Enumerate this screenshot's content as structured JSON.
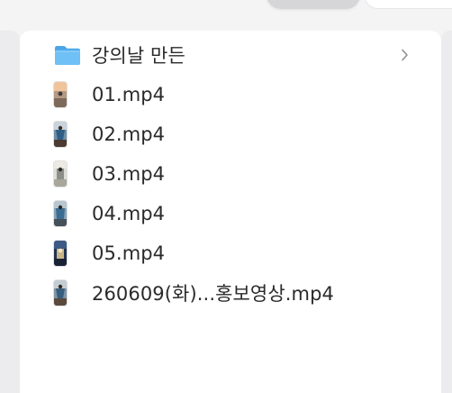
{
  "file_list": {
    "items": [
      {
        "type": "folder",
        "label": "강의날 만든",
        "icon": "folder-icon",
        "color": "#5bb3ef",
        "has_chevron": true
      },
      {
        "type": "video",
        "label": "01.mp4",
        "icon": "video-thumbnail-icon"
      },
      {
        "type": "video",
        "label": "02.mp4",
        "icon": "video-thumbnail-icon"
      },
      {
        "type": "video",
        "label": "03.mp4",
        "icon": "video-thumbnail-icon"
      },
      {
        "type": "video",
        "label": "04.mp4",
        "icon": "video-thumbnail-icon"
      },
      {
        "type": "video",
        "label": "05.mp4",
        "icon": "video-thumbnail-icon"
      },
      {
        "type": "video",
        "label": "260609(화)...홍보영상.mp4",
        "icon": "video-thumbnail-icon"
      }
    ]
  }
}
